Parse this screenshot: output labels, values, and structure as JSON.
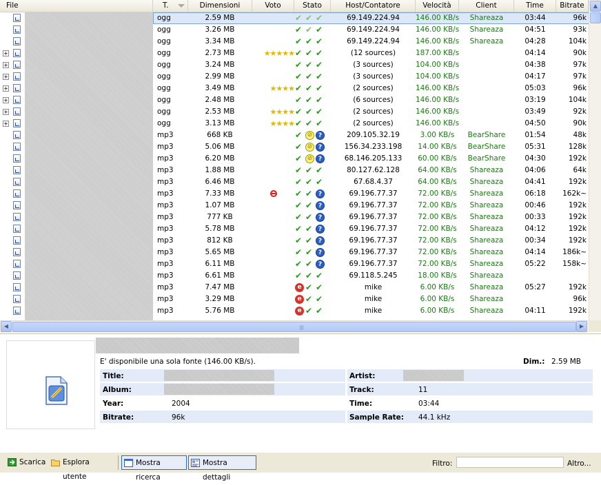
{
  "columns": {
    "file": "File",
    "type": "T.",
    "size": "Dimensioni",
    "rating": "Voto",
    "status": "Stato",
    "host": "Host/Contatore",
    "speed": "Velocità",
    "client": "Client",
    "time": "Time",
    "bitrate": "Bitrate"
  },
  "rows": [
    {
      "expand": false,
      "type": "ogg",
      "size": "2.59 MB",
      "rating": "",
      "st": [
        "chk-dim",
        "chk-dim",
        "chk-dim"
      ],
      "host": "69.149.224.94",
      "speed": "146.00 KB/s",
      "client": "Shareaza",
      "time": "03:44",
      "bitrate": "96k",
      "selected": true
    },
    {
      "expand": false,
      "type": "ogg",
      "size": "3.26 MB",
      "rating": "",
      "st": [
        "chk",
        "chk-dim",
        "chk"
      ],
      "host": "69.149.224.94",
      "speed": "146.00 KB/s",
      "client": "Shareaza",
      "time": "04:51",
      "bitrate": "93k"
    },
    {
      "expand": false,
      "type": "ogg",
      "size": "3.34 MB",
      "rating": "",
      "st": [
        "chk",
        "chk",
        "chk"
      ],
      "host": "69.149.224.94",
      "speed": "146.00 KB/s",
      "client": "Shareaza",
      "time": "04:28",
      "bitrate": "104k"
    },
    {
      "expand": true,
      "type": "ogg",
      "size": "2.73 MB",
      "rating": "★★★★★",
      "st": [
        "chk",
        "chk",
        "chk"
      ],
      "host": "(12 sources)",
      "speed": "187.00 KB/s",
      "client": "",
      "time": "04:14",
      "bitrate": "90k"
    },
    {
      "expand": true,
      "type": "ogg",
      "size": "3.24 MB",
      "rating": "",
      "st": [
        "chk",
        "chk",
        "chk"
      ],
      "host": "(3 sources)",
      "speed": "104.00 KB/s",
      "client": "",
      "time": "04:38",
      "bitrate": "97k"
    },
    {
      "expand": true,
      "type": "ogg",
      "size": "2.99 MB",
      "rating": "",
      "st": [
        "chk",
        "chk",
        "chk"
      ],
      "host": "(3 sources)",
      "speed": "104.00 KB/s",
      "client": "",
      "time": "04:17",
      "bitrate": "97k"
    },
    {
      "expand": true,
      "type": "ogg",
      "size": "3.49 MB",
      "rating": "★★★★",
      "st": [
        "chk",
        "chk",
        "chk"
      ],
      "host": "(2 sources)",
      "speed": "146.00 KB/s",
      "client": "",
      "time": "05:03",
      "bitrate": "96k"
    },
    {
      "expand": true,
      "type": "ogg",
      "size": "2.48 MB",
      "rating": "",
      "st": [
        "chk",
        "chk",
        "chk"
      ],
      "host": "(6 sources)",
      "speed": "146.00 KB/s",
      "client": "",
      "time": "03:19",
      "bitrate": "104k"
    },
    {
      "expand": true,
      "type": "ogg",
      "size": "2.53 MB",
      "rating": "★★★★",
      "st": [
        "chk",
        "chk",
        "chk"
      ],
      "host": "(2 sources)",
      "speed": "146.00 KB/s",
      "client": "",
      "time": "03:49",
      "bitrate": "92k"
    },
    {
      "expand": true,
      "type": "ogg",
      "size": "3.13 MB",
      "rating": "★★★★",
      "st": [
        "chk",
        "chk",
        "chk"
      ],
      "host": "(2 sources)",
      "speed": "146.00 KB/s",
      "client": "",
      "time": "04:50",
      "bitrate": "90k"
    },
    {
      "expand": false,
      "type": "mp3",
      "size": "668 KB",
      "rating": "",
      "st": [
        "chk",
        "zz",
        "q"
      ],
      "host": "209.105.32.19",
      "speed": "3.00 KB/s",
      "client": "BearShare",
      "time": "01:54",
      "bitrate": "48k"
    },
    {
      "expand": false,
      "type": "mp3",
      "size": "5.06 MB",
      "rating": "",
      "st": [
        "chk",
        "zz",
        "q"
      ],
      "host": "156.34.233.198",
      "speed": "14.00 KB/s",
      "client": "BearShare",
      "time": "05:31",
      "bitrate": "128k"
    },
    {
      "expand": false,
      "type": "mp3",
      "size": "6.20 MB",
      "rating": "",
      "st": [
        "chk",
        "zz",
        "q"
      ],
      "host": "68.146.205.133",
      "speed": "60.00 KB/s",
      "client": "BearShare",
      "time": "04:30",
      "bitrate": "192k"
    },
    {
      "expand": false,
      "type": "mp3",
      "size": "1.88 MB",
      "rating": "",
      "st": [
        "chk",
        "chk",
        "chk"
      ],
      "host": "80.127.62.128",
      "speed": "64.00 KB/s",
      "client": "Shareaza",
      "time": "04:06",
      "bitrate": "64k"
    },
    {
      "expand": false,
      "type": "mp3",
      "size": "6.46 MB",
      "rating": "",
      "st": [
        "chk",
        "chk",
        "chk"
      ],
      "host": "67.68.4.37",
      "speed": "64.00 KB/s",
      "client": "Shareaza",
      "time": "04:41",
      "bitrate": "192k"
    },
    {
      "expand": false,
      "type": "mp3",
      "size": "7.33 MB",
      "rating": "ban",
      "st": [
        "chk",
        "chk",
        "q"
      ],
      "host": "69.196.77.37",
      "speed": "72.00 KB/s",
      "client": "Shareaza",
      "time": "06:18",
      "bitrate": "162k~"
    },
    {
      "expand": false,
      "type": "mp3",
      "size": "1.07 MB",
      "rating": "",
      "st": [
        "chk",
        "chk",
        "q"
      ],
      "host": "69.196.77.37",
      "speed": "72.00 KB/s",
      "client": "Shareaza",
      "time": "00:46",
      "bitrate": "192k"
    },
    {
      "expand": false,
      "type": "mp3",
      "size": "777 KB",
      "rating": "",
      "st": [
        "chk",
        "chk",
        "q"
      ],
      "host": "69.196.77.37",
      "speed": "72.00 KB/s",
      "client": "Shareaza",
      "time": "00:33",
      "bitrate": "192k"
    },
    {
      "expand": false,
      "type": "mp3",
      "size": "5.78 MB",
      "rating": "",
      "st": [
        "chk",
        "chk",
        "q"
      ],
      "host": "69.196.77.37",
      "speed": "72.00 KB/s",
      "client": "Shareaza",
      "time": "04:12",
      "bitrate": "192k"
    },
    {
      "expand": false,
      "type": "mp3",
      "size": "812 KB",
      "rating": "",
      "st": [
        "chk",
        "chk",
        "q"
      ],
      "host": "69.196.77.37",
      "speed": "72.00 KB/s",
      "client": "Shareaza",
      "time": "00:34",
      "bitrate": "192k"
    },
    {
      "expand": false,
      "type": "mp3",
      "size": "5.65 MB",
      "rating": "",
      "st": [
        "chk",
        "chk",
        "q"
      ],
      "host": "69.196.77.37",
      "speed": "72.00 KB/s",
      "client": "Shareaza",
      "time": "04:14",
      "bitrate": "186k~"
    },
    {
      "expand": false,
      "type": "mp3",
      "size": "6.11 MB",
      "rating": "",
      "st": [
        "chk",
        "chk",
        "q"
      ],
      "host": "69.196.77.37",
      "speed": "72.00 KB/s",
      "client": "Shareaza",
      "time": "05:22",
      "bitrate": "158k~"
    },
    {
      "expand": false,
      "type": "mp3",
      "size": "6.61 MB",
      "rating": "",
      "st": [
        "chk",
        "chk",
        "chk"
      ],
      "host": "69.118.5.245",
      "speed": "18.00 KB/s",
      "client": "Shareaza",
      "time": "",
      "bitrate": ""
    },
    {
      "expand": false,
      "type": "mp3",
      "size": "7.47 MB",
      "rating": "",
      "st": [
        "ee",
        "chk",
        "chk"
      ],
      "host": "mike",
      "speed": "6.00 KB/s",
      "client": "Shareaza",
      "time": "05:27",
      "bitrate": "192k"
    },
    {
      "expand": false,
      "type": "mp3",
      "size": "3.29 MB",
      "rating": "",
      "st": [
        "ee",
        "chk",
        "chk"
      ],
      "host": "mike",
      "speed": "6.00 KB/s",
      "client": "Shareaza",
      "time": "",
      "bitrate": "96k"
    },
    {
      "expand": false,
      "type": "mp3",
      "size": "5.76 MB",
      "rating": "",
      "st": [
        "ee",
        "chk",
        "chk"
      ],
      "host": "mike",
      "speed": "6.00 KB/s",
      "client": "Shareaza",
      "time": "04:11",
      "bitrate": "192k"
    }
  ],
  "details": {
    "availability": "E' disponibile una sola fonte (146.00 KB/s).",
    "dim_label": "Dim.:",
    "dim_value": "2.59 MB",
    "title_label": "Title:",
    "album_label": "Album:",
    "year_label": "Year:",
    "year_value": "2004",
    "bitrate_label": "Bitrate:",
    "bitrate_value": "96k",
    "artist_label": "Artist:",
    "track_label": "Track:",
    "track_value": "11",
    "time_label": "Time:",
    "time_value": "03:44",
    "samplerate_label": "Sample Rate:",
    "samplerate_value": "44.1 kHz"
  },
  "toolbar": {
    "download": "Scarica",
    "browse_user": "Esplora utente",
    "show_search": "Mostra ricerca",
    "show_details": "Mostra dettagli",
    "filter_label": "Filtro:",
    "filter_value": "",
    "more": "Altro..."
  },
  "icons": {
    "download": "download-arrow-icon",
    "browse": "folder-icon",
    "search": "search-window-icon",
    "details": "details-icon",
    "file_type": "audio-file-icon"
  }
}
